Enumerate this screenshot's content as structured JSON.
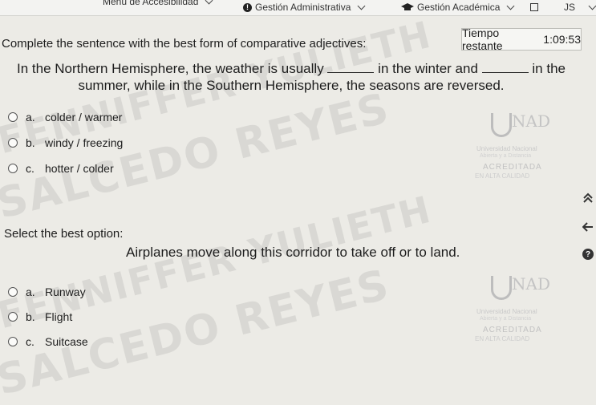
{
  "topbar": {
    "accessibility_menu": "Menú de Accesibilidad",
    "admin": "Gestión Administrativa",
    "academic": "Gestión Académica",
    "user_initials": "JS"
  },
  "instructions": "Complete the sentence with the best form of comparative adjectives:",
  "timer": {
    "label": "Tiempo restante",
    "value": "1:09:53"
  },
  "question1": {
    "part1": "In the Northern Hemisphere, the weather is usually",
    "part2": "in the winter and",
    "part3": "in the",
    "part4": "summer, while in the Southern Hemisphere, the seasons are reversed.",
    "options": [
      {
        "letter": "a.",
        "text": "colder / warmer"
      },
      {
        "letter": "b.",
        "text": "windy / freezing"
      },
      {
        "letter": "c.",
        "text": "hotter / colder"
      }
    ]
  },
  "question2": {
    "instructions": "Select the best option:",
    "sentence": "Airplanes move along this corridor to take off or to land.",
    "options": [
      {
        "letter": "a.",
        "text": "Runway"
      },
      {
        "letter": "b.",
        "text": "Flight"
      },
      {
        "letter": "c.",
        "text": "Suitcase"
      }
    ]
  },
  "watermark": {
    "line1": "FENNIFFER YULIETH",
    "line2": "SALCEDO REYES"
  },
  "logo": {
    "mark": "NAD",
    "line1": "Universidad Nacional",
    "line2": "Abierta y a Distancia",
    "line3": "ACREDITADA",
    "line4": "EN ALTA CALIDAD"
  },
  "icons": {
    "scroll_up": "chevron-double-up-icon",
    "back": "arrow-left-icon",
    "help": "help-icon"
  }
}
